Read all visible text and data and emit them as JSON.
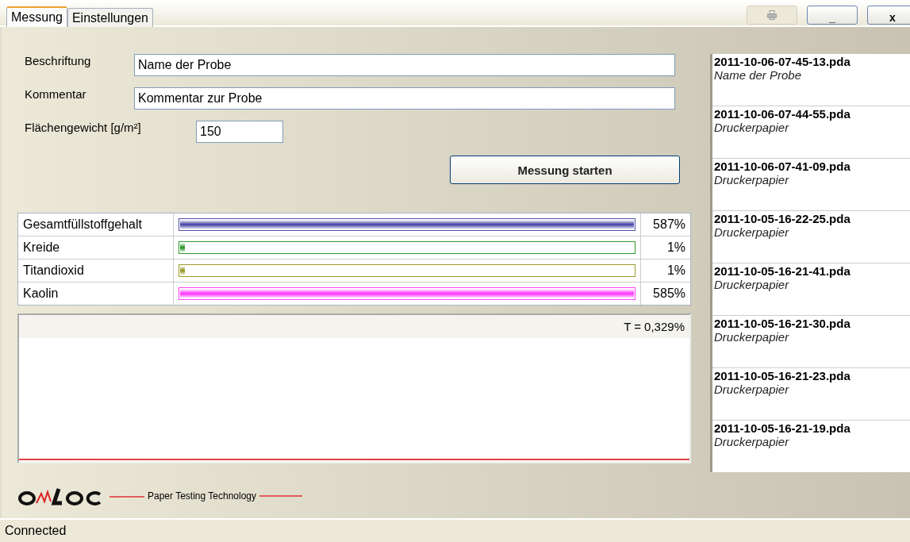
{
  "tabs": [
    {
      "label": "Messung",
      "selected": true
    },
    {
      "label": "Einstellungen",
      "selected": false
    }
  ],
  "window_buttons": [
    {
      "kind": "print",
      "disabled": true
    },
    {
      "kind": "text",
      "label": "_",
      "disabled": false
    },
    {
      "kind": "text",
      "label": "x",
      "disabled": false
    }
  ],
  "form": {
    "fields": [
      {
        "label": "Beschriftung",
        "value": "Name der Probe",
        "kind": "wide"
      },
      {
        "label": "Kommentar",
        "value": "Kommentar zur Probe",
        "kind": "wide"
      },
      {
        "label": "Flächengewicht [g/m²]",
        "value": "150",
        "kind": "short"
      }
    ],
    "button": "Messung starten"
  },
  "components": [
    {
      "name": "Gesamtfüllstoffgehalt",
      "level": 1,
      "color": "#5050a8",
      "reading": "587%"
    },
    {
      "name": "Kreide",
      "level": 0.01,
      "color": "#2c9a2c",
      "reading": "1%"
    },
    {
      "name": "Titandioxid",
      "level": 0.01,
      "color": "#9a9a28",
      "reading": "1%"
    },
    {
      "name": "Kaolin",
      "level": 1,
      "color": "#ff40ff",
      "reading": "585%"
    }
  ],
  "plot": {
    "reading": "T = 0,329%"
  },
  "files": [
    {
      "name": "2011-10-06-07-45-13.pda",
      "comment": "Name der Probe"
    },
    {
      "name": "2011-10-06-07-44-55.pda",
      "comment": "Druckerpapier"
    },
    {
      "name": "2011-10-06-07-41-09.pda",
      "comment": "Druckerpapier"
    },
    {
      "name": "2011-10-05-16-22-25.pda",
      "comment": "Druckerpapier"
    },
    {
      "name": "2011-10-05-16-21-41.pda",
      "comment": "Druckerpapier"
    },
    {
      "name": "2011-10-05-16-21-30.pda",
      "comment": "Druckerpapier"
    },
    {
      "name": "2011-10-05-16-21-23.pda",
      "comment": "Druckerpapier"
    },
    {
      "name": "2011-10-05-16-21-19.pda",
      "comment": "Druckerpapier"
    }
  ],
  "brand": {
    "tagline": "Paper Testing Technology"
  },
  "status_bar": "Connected"
}
